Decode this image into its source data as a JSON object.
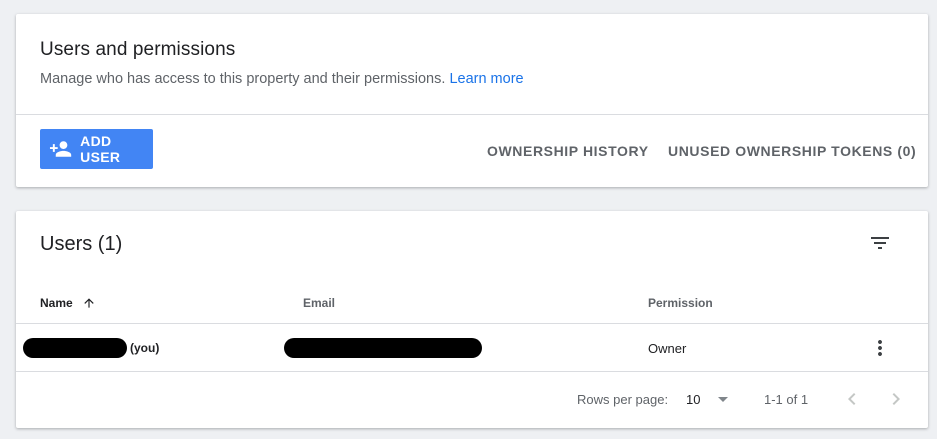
{
  "permissions_card": {
    "title": "Users and permissions",
    "subtitle": "Manage who has access to this property and their permissions.",
    "learn_more": "Learn more",
    "add_user_label": "ADD USER",
    "ownership_history_label": "OWNERSHIP HISTORY",
    "unused_tokens_label": "UNUSED OWNERSHIP TOKENS (0)"
  },
  "users_card": {
    "title": "Users (1)",
    "columns": {
      "name": "Name",
      "email": "Email",
      "permission": "Permission"
    },
    "sort": "name ascending",
    "rows": [
      {
        "you_suffix": "(you)",
        "permission": "Owner"
      }
    ],
    "footer": {
      "rows_per_page_label": "Rows per page:",
      "rows_per_page_value": "10",
      "range": "1-1 of 1"
    }
  },
  "colors": {
    "accent": "#4285f4",
    "link": "#1a73e8",
    "muted_text": "#5f6368",
    "divider": "#dadce0",
    "background": "#eef0f3"
  },
  "icons": [
    "person-add-icon",
    "arrow-up-icon",
    "filter-icon",
    "more-vert-icon",
    "arrow-drop-down-icon",
    "chevron-left-icon",
    "chevron-right-icon"
  ]
}
